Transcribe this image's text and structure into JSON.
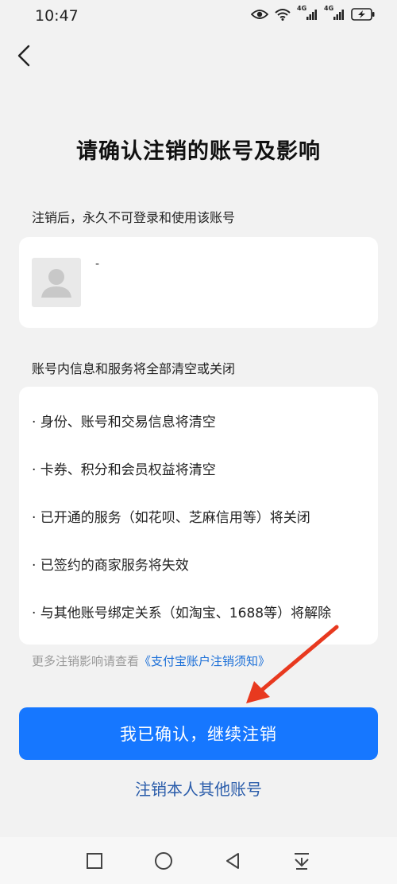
{
  "status_bar": {
    "time": "10:47",
    "network_1": "4G",
    "network_2": "4G",
    "icons": [
      "eye-icon",
      "wifi-icon",
      "signal-icon",
      "signal-icon",
      "battery-charging-icon"
    ]
  },
  "header": {
    "back_icon": "chevron-left-icon"
  },
  "page": {
    "title": "请确认注销的账号及影响",
    "account_section_label": "注销后，永久不可登录和使用该账号",
    "account": {
      "name": "-",
      "avatar_icon": "user-avatar-icon"
    },
    "info_section_label": "账号内信息和服务将全部清空或关闭",
    "info_items": [
      "· 身份、账号和交易信息将清空",
      "· 卡券、积分和会员权益将清空",
      "· 已开通的服务（如花呗、芝麻信用等）将关闭",
      "· 已签约的商家服务将失效",
      "· 与其他账号绑定关系（如淘宝、1688等）将解除"
    ],
    "notice_prefix": "更多注销影响请查看",
    "notice_link": "《支付宝账户注销须知》",
    "confirm_button": "我已确认，继续注销",
    "other_account_link": "注销本人其他账号"
  },
  "colors": {
    "accent": "#1677ff",
    "link": "#1b6fd8",
    "arrow": "#e8391f",
    "background": "#f2f2f2"
  },
  "nav_bar": {
    "icons": [
      "square-recents-icon",
      "circle-home-icon",
      "triangle-back-icon",
      "download-arrow-icon"
    ]
  }
}
